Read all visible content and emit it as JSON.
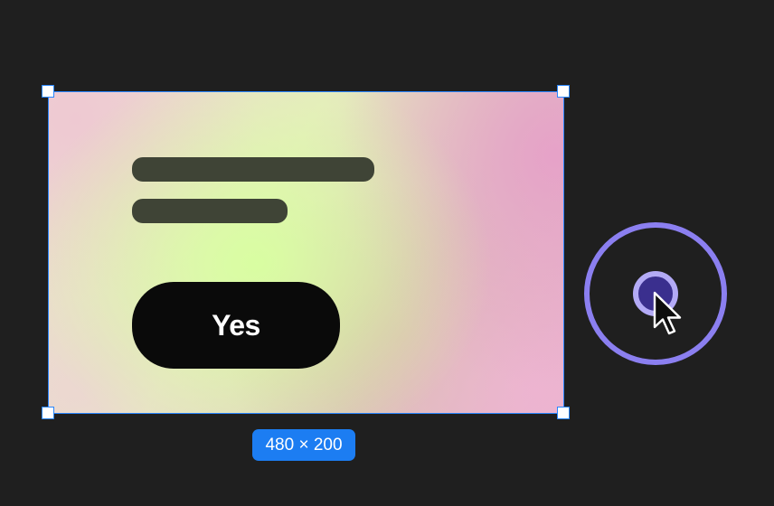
{
  "canvas": {
    "selected_frame": {
      "button_label": "Yes"
    },
    "dimension_badge": "480 × 200",
    "tap_indicator": {
      "icon": "cursor-arrow-icon"
    }
  },
  "colors": {
    "background": "#1f1f1f",
    "selection": "#2a86ff",
    "badge": "#1c7df2",
    "tap_ring": "#8b7ff0",
    "tap_dot": "#3a2f8e",
    "button": "#0a0a0a",
    "placeholder_text": "#3f4436"
  }
}
